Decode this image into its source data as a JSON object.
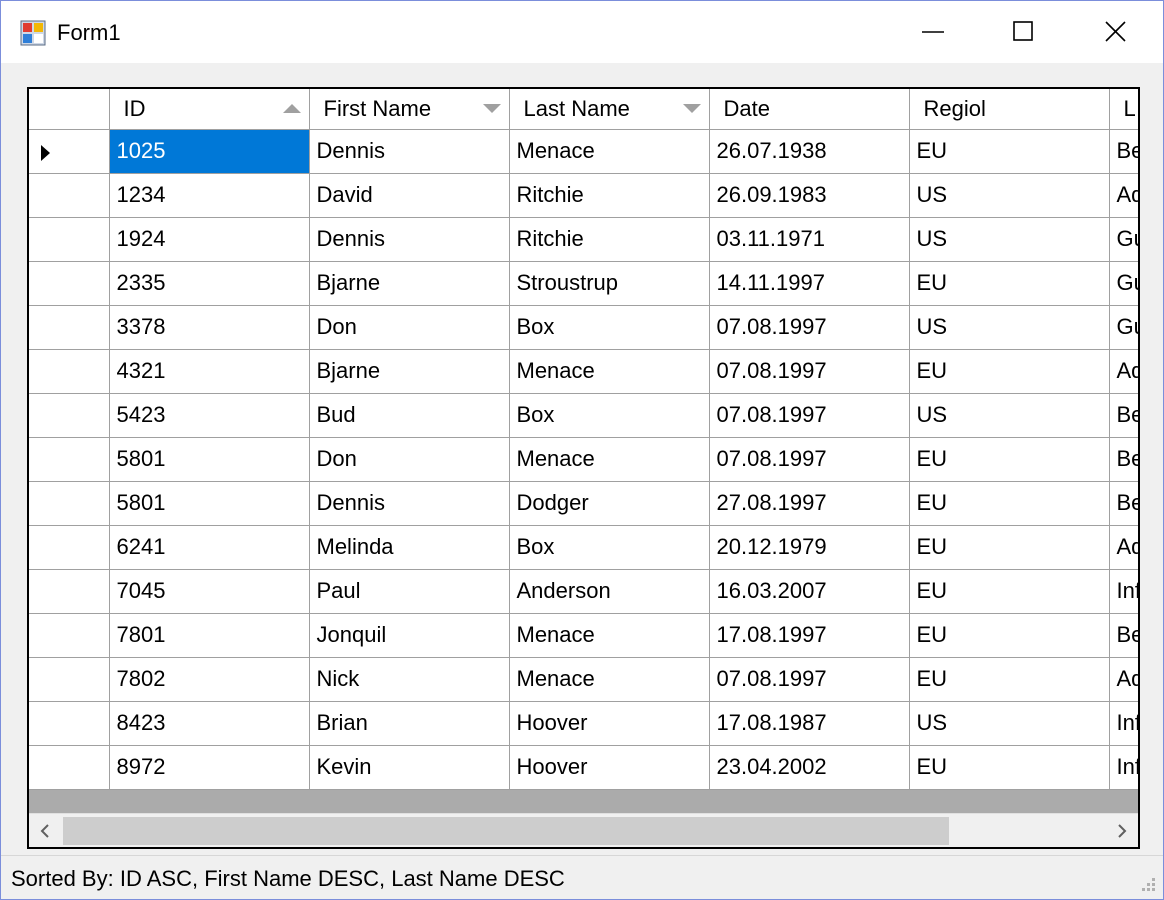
{
  "window": {
    "title": "Form1"
  },
  "grid": {
    "columns": [
      {
        "label": "ID",
        "sort": "asc"
      },
      {
        "label": "First Name",
        "sort": "desc"
      },
      {
        "label": "Last Name",
        "sort": "desc"
      },
      {
        "label": "Date",
        "sort": ""
      },
      {
        "label": "Regiol",
        "sort": ""
      },
      {
        "label": "L",
        "sort": ""
      }
    ],
    "selected_row": 0,
    "rows": [
      [
        "1025",
        "Dennis",
        "Menace",
        "26.07.1938",
        "EU",
        "Be"
      ],
      [
        "1234",
        "David",
        "Ritchie",
        "26.09.1983",
        "US",
        "Ad"
      ],
      [
        "1924",
        "Dennis",
        "Ritchie",
        "03.11.1971",
        "US",
        "Gu"
      ],
      [
        "2335",
        "Bjarne",
        "Stroustrup",
        "14.11.1997",
        "EU",
        "Gu"
      ],
      [
        "3378",
        "Don",
        "Box",
        "07.08.1997",
        "US",
        "Gu"
      ],
      [
        "4321",
        "Bjarne",
        "Menace",
        "07.08.1997",
        "EU",
        "Ad"
      ],
      [
        "5423",
        "Bud",
        "Box",
        "07.08.1997",
        "US",
        "Be"
      ],
      [
        "5801",
        "Don",
        "Menace",
        "07.08.1997",
        "EU",
        "Be"
      ],
      [
        "5801",
        "Dennis",
        "Dodger",
        "27.08.1997",
        "EU",
        "Be"
      ],
      [
        "6241",
        "Melinda",
        "Box",
        "20.12.1979",
        "EU",
        "Ad"
      ],
      [
        "7045",
        "Paul",
        "Anderson",
        "16.03.2007",
        "EU",
        "Inf"
      ],
      [
        "7801",
        "Jonquil",
        "Menace",
        "17.08.1997",
        "EU",
        "Be"
      ],
      [
        "7802",
        "Nick",
        "Menace",
        "07.08.1997",
        "EU",
        "Ad"
      ],
      [
        "8423",
        "Brian",
        "Hoover",
        "17.08.1987",
        "US",
        "Inf"
      ],
      [
        "8972",
        "Kevin",
        "Hoover",
        "23.04.2002",
        "EU",
        "Inf"
      ]
    ]
  },
  "status": {
    "text": "Sorted By: ID ASC, First Name DESC, Last Name DESC"
  },
  "icons": {
    "app": "app-icon",
    "minimize": "minimize-icon",
    "maximize": "maximize-icon",
    "close": "close-icon",
    "scroll_left": "chevron-left-icon",
    "scroll_right": "chevron-right-icon"
  },
  "colors": {
    "selection": "#0078d7",
    "window_border": "#7b8edb",
    "grid_lines": "#a0a0a0"
  }
}
